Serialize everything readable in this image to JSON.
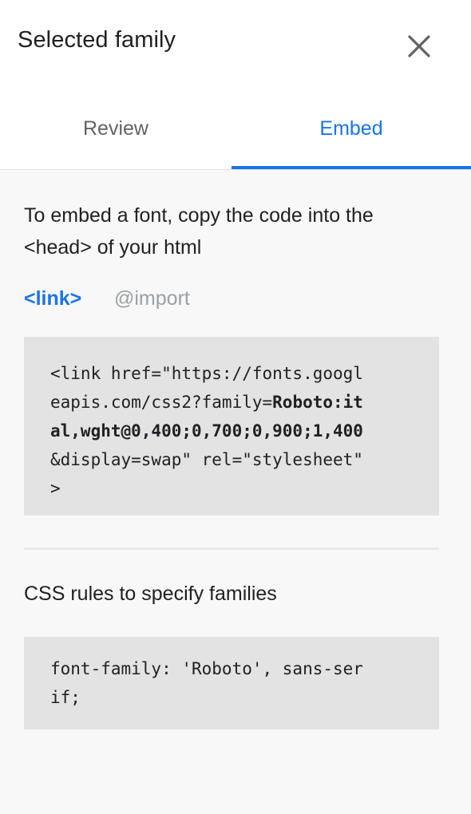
{
  "panel": {
    "title": "Selected family",
    "close_icon": "close-icon"
  },
  "tabs": [
    {
      "label": "Review",
      "active": false
    },
    {
      "label": "Embed",
      "active": true
    }
  ],
  "embed": {
    "intro_line1": "To embed a font, copy the code into the",
    "intro_line2": "<head> of your html",
    "subtabs": [
      {
        "label": "<link>",
        "active": true
      },
      {
        "label": "@import",
        "active": false
      }
    ],
    "link_code": {
      "line1": "<link href=\"https://fonts.googl",
      "line2_pre": "eapis.com/css2?family=",
      "line2_bold": "Roboto:it",
      "line3_bold": "al,wght@0,400;0,700;0,900;1,400",
      "line4": "&display=swap\" rel=\"stylesheet\"",
      "line5": ">"
    },
    "css_heading": "CSS rules to specify families",
    "css_code": {
      "line1": "font-family: 'Roboto', sans-ser",
      "line2": "if;"
    }
  },
  "colors": {
    "accent": "#1a73e8",
    "code_bg": "#e3e3e3",
    "panel_bg": "#f8f8f8"
  }
}
